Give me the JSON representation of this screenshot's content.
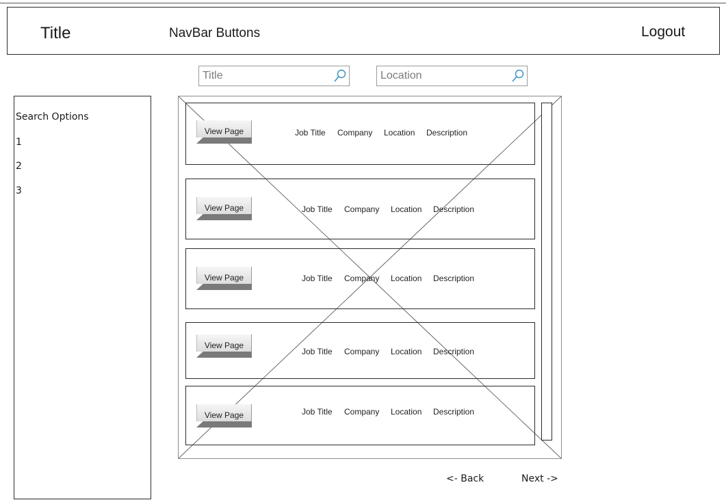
{
  "header": {
    "title": "Title",
    "nav": "NavBar Buttons",
    "logout": "Logout"
  },
  "search": {
    "title_placeholder": "Title",
    "location_placeholder": "Location",
    "icon": "magnifier-icon"
  },
  "sidebar": {
    "heading": "Search Options",
    "options": [
      "1",
      "2",
      "3"
    ]
  },
  "results": {
    "placeholder_icon": "image-placeholder-x",
    "rows": [
      {
        "button": "View Page",
        "job_title": "Job Title",
        "company": "Company",
        "location": "Location",
        "description": "Description"
      },
      {
        "button": "View Page",
        "job_title": "Job Title",
        "company": "Company",
        "location": "Location",
        "description": "Description"
      },
      {
        "button": "View Page",
        "job_title": "Job Title",
        "company": "Company",
        "location": "Location",
        "description": "Description"
      },
      {
        "button": "View Page",
        "job_title": "Job Title",
        "company": "Company",
        "location": "Location",
        "description": "Description"
      },
      {
        "button": "View Page",
        "job_title": "Job Title",
        "company": "Company",
        "location": "Location",
        "description": "Description"
      }
    ]
  },
  "pagination": {
    "back": "<- Back",
    "next": "Next ->"
  },
  "colors": {
    "sketch_line": "#2a2a2a",
    "search_icon": "#3a8fc0",
    "button_shadow": "#7a7a7a"
  }
}
